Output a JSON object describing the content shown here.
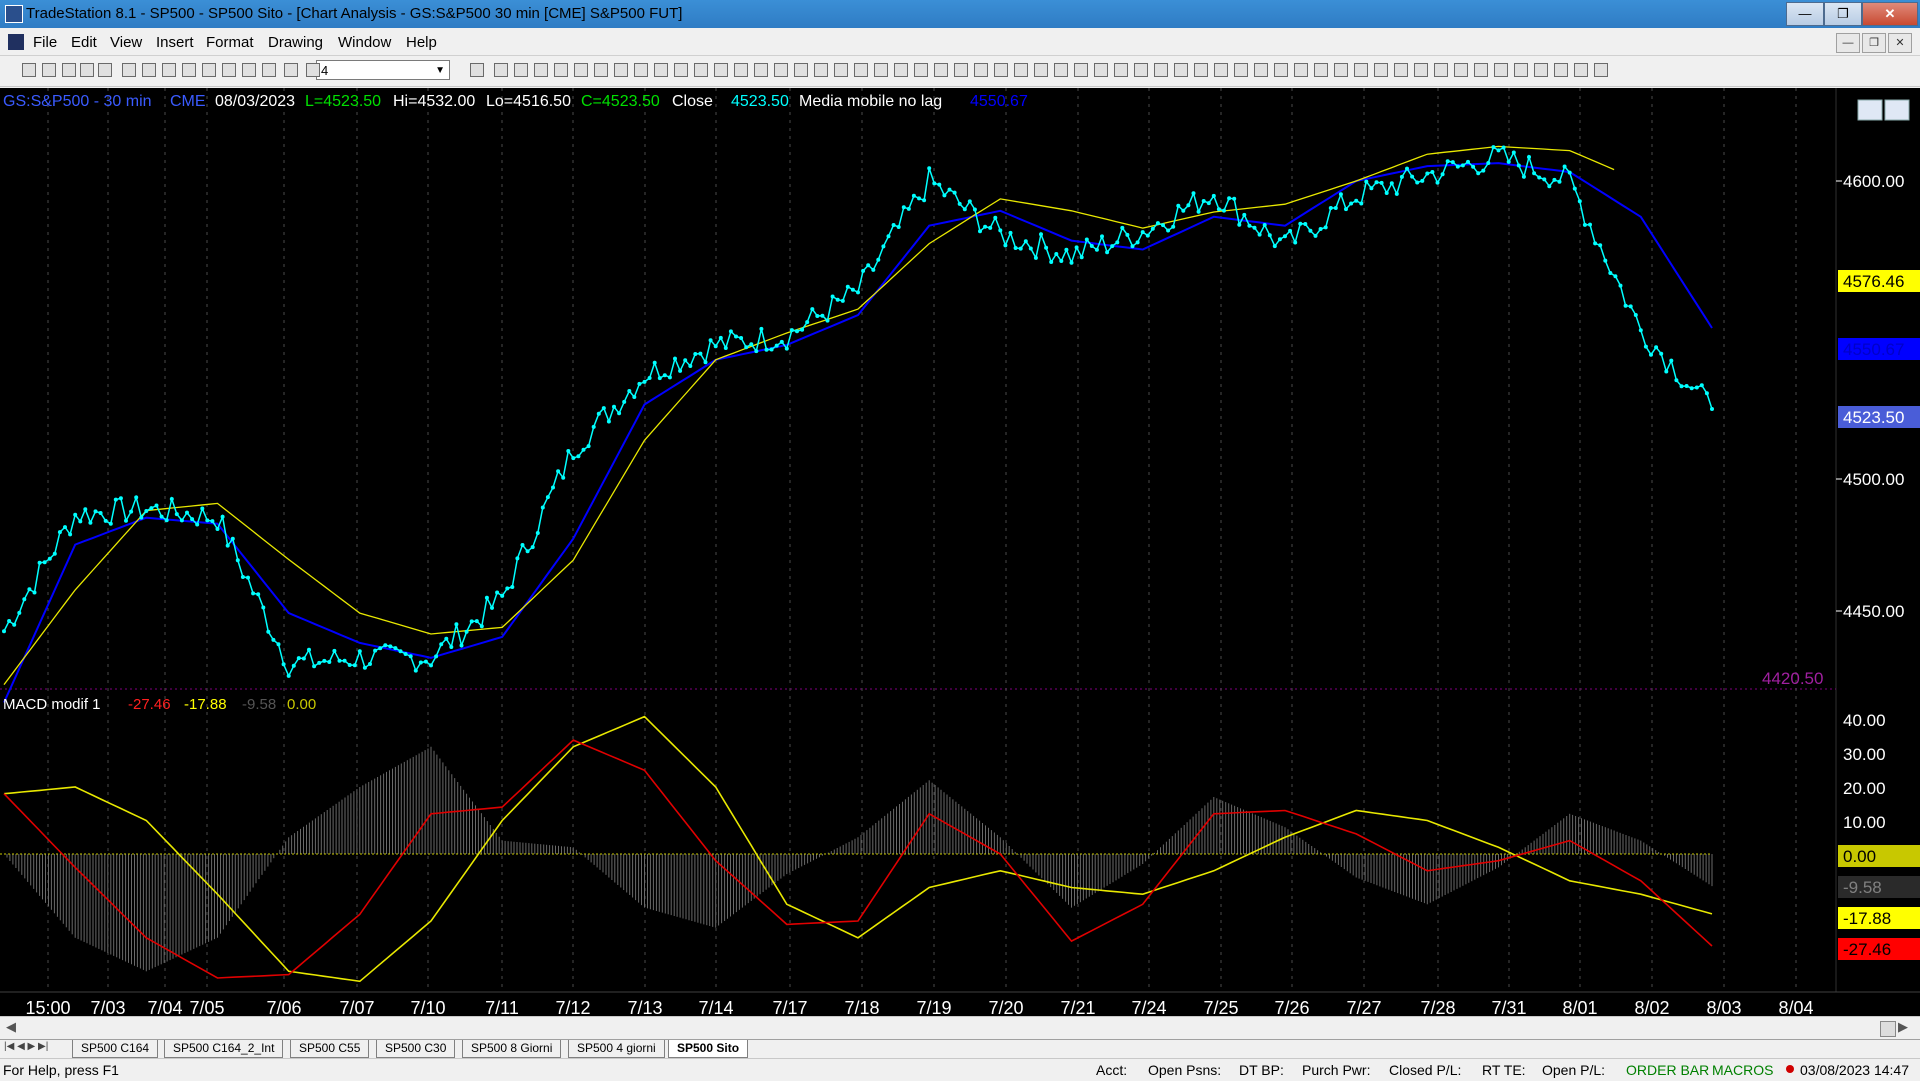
{
  "window": {
    "title": "TradeStation 8.1 - SP500 - SP500 Sito - [Chart Analysis - GS:S&P500  30 min  [CME] S&P500 FUT]"
  },
  "menu": [
    "File",
    "Edit",
    "View",
    "Insert",
    "Format",
    "Drawing",
    "Window",
    "Help"
  ],
  "toolbar": {
    "interval_value": "4"
  },
  "chart": {
    "header": {
      "symbol": "GS:S&P500 - 30 min",
      "exchange": "CME",
      "date": "08/03/2023",
      "last": "L=4523.50",
      "high": "Hi=4532.00",
      "low": "Lo=4516.50",
      "close": "C=4523.50",
      "close_label": "Close",
      "close_value": "4523.50",
      "ma_label": "Media mobile no lag",
      "ma_value": "4550.67"
    },
    "price_axis": [
      "4600.00",
      "4500.00",
      "4450.00"
    ],
    "price_marker_min": "4420.50",
    "price_flags": [
      {
        "value": "4576.46",
        "color": "#ffff00",
        "text_color": "#000000"
      },
      {
        "value": "4550.67",
        "color": "#0000ff",
        "text_color": "#0000c8"
      },
      {
        "value": "4523.50",
        "color": "#4a5dd8",
        "text_color": "#ffffff"
      }
    ],
    "macd_header": {
      "name": "MACD modif 1",
      "v1": "-27.46",
      "v2": "-17.88",
      "v3": "-9.58",
      "v4": "0.00"
    },
    "macd_axis": [
      "40.00",
      "30.00",
      "20.00",
      "10.00"
    ],
    "macd_flags": [
      {
        "value": "0.00",
        "color": "#c8c800",
        "text_color": "#000000"
      },
      {
        "value": "-9.58",
        "color": "#2a2a2a",
        "text_color": "#808080"
      },
      {
        "value": "-17.88",
        "color": "#ffff00",
        "text_color": "#000000"
      },
      {
        "value": "-27.46",
        "color": "#ff0000",
        "text_color": "#000000"
      }
    ],
    "time_labels": [
      "15:00",
      "7/03",
      "7/04",
      "7/05",
      "7/06",
      "7/07",
      "7/10",
      "7/11",
      "7/12",
      "7/13",
      "7/14",
      "7/17",
      "7/18",
      "7/19",
      "7/20",
      "7/21",
      "7/24",
      "7/25",
      "7/26",
      "7/27",
      "7/28",
      "7/31",
      "8/01",
      "8/02",
      "8/03",
      "8/04"
    ]
  },
  "chart_data": {
    "type": "line",
    "title": "",
    "x": [
      "15:00",
      "7/03",
      "7/04",
      "7/05",
      "7/06",
      "7/07",
      "7/10",
      "7/11",
      "7/12",
      "7/13",
      "7/14",
      "7/17",
      "7/18",
      "7/19",
      "7/20",
      "7/21",
      "7/24",
      "7/25",
      "7/26",
      "7/27",
      "7/28",
      "7/31",
      "8/01",
      "8/02",
      "8/03"
    ],
    "series": [
      {
        "name": "Close",
        "values": [
          4449,
          4488,
          4490,
          4487,
          4438,
          4440,
          4440,
          4460,
          4510,
          4535,
          4545,
          4548,
          4563,
          4600,
          4582,
          4575,
          4583,
          4596,
          4578,
          4595,
          4602,
          4608,
          4600,
          4550,
          4523.5
        ]
      },
      {
        "name": "Media mobile no lag",
        "values": [
          4425,
          4478,
          4487,
          4485,
          4455,
          4445,
          4440,
          4447,
          4480,
          4525,
          4540,
          4545,
          4555,
          4585,
          4590,
          4580,
          4577,
          4588,
          4585,
          4600,
          4605,
          4606,
          4603,
          4588,
          4550.67
        ]
      }
    ],
    "ylim": [
      4420,
      4650
    ],
    "macd": {
      "name": "MACD modif 1",
      "series": [
        {
          "name": "MACD",
          "values": [
            18,
            -4,
            -25,
            -37,
            -36,
            -18,
            12,
            14,
            34,
            25,
            -2,
            -21,
            -20,
            12,
            0,
            -26,
            -15,
            12,
            13,
            6,
            -5,
            -2,
            4,
            -8,
            -27.46
          ]
        },
        {
          "name": "Signal",
          "values": [
            18,
            20,
            10,
            -12,
            -35,
            -38,
            -20,
            10,
            32,
            41,
            20,
            -15,
            -25,
            -10,
            -5,
            -10,
            -12,
            -5,
            5,
            13,
            10,
            2,
            -8,
            -12,
            -17.88
          ]
        },
        {
          "name": "Histogram",
          "values": [
            0,
            -25,
            -35,
            -25,
            5,
            20,
            32,
            4,
            2,
            -16,
            -22,
            -6,
            5,
            22,
            5,
            -16,
            -3,
            17,
            8,
            -7,
            -15,
            -4,
            12,
            4,
            -9.58
          ]
        }
      ],
      "ylim": [
        -40,
        45
      ]
    }
  },
  "statusbar": {
    "help": "For Help, press F1",
    "acct": "Acct:",
    "open_psns": "Open Psns:",
    "dt_bp": "DT BP:",
    "purch_pwr": "Purch Pwr:",
    "closed_pl": "Closed P/L:",
    "rt_te": "RT TE:",
    "open_pl": "Open P/L:",
    "order_bar": "ORDER BAR",
    "macros": "MACROS",
    "datetime": "03/08/2023 14:47"
  },
  "tabs": [
    "SP500 C164",
    "SP500 C164_2_Int",
    "SP500 C55",
    "SP500 C30",
    "SP500 8 Giorni",
    "SP500 4 giorni",
    "SP500 Sito"
  ]
}
